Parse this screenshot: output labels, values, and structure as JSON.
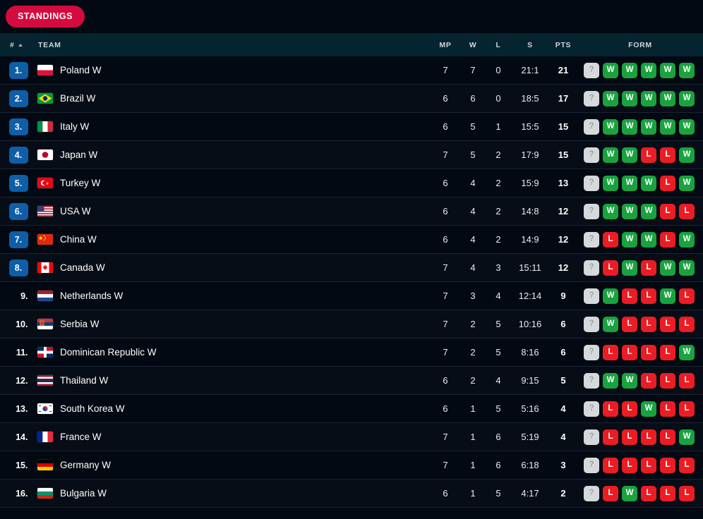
{
  "tabs": [
    {
      "label": "STANDINGS",
      "active": true
    }
  ],
  "colors": {
    "accent": "#d40b3f",
    "rank_badge": "#0f5ea8",
    "win": "#19a33f",
    "loss": "#ec1c24",
    "unknown": "#d6d9db"
  },
  "table": {
    "headers": {
      "rank": "#",
      "sort_indicator": "ascending",
      "team": "TEAM",
      "mp": "MP",
      "w": "W",
      "l": "L",
      "s": "S",
      "pts": "PTS",
      "form": "FORM"
    },
    "rows": [
      {
        "rank": "1.",
        "highlight": true,
        "team": "Poland W",
        "flag": "poland",
        "mp": "7",
        "w": "7",
        "l": "0",
        "s": "21:1",
        "pts": "21",
        "form": [
          "?",
          "W",
          "W",
          "W",
          "W",
          "W"
        ]
      },
      {
        "rank": "2.",
        "highlight": true,
        "team": "Brazil W",
        "flag": "brazil",
        "mp": "6",
        "w": "6",
        "l": "0",
        "s": "18:5",
        "pts": "17",
        "form": [
          "?",
          "W",
          "W",
          "W",
          "W",
          "W"
        ]
      },
      {
        "rank": "3.",
        "highlight": true,
        "team": "Italy W",
        "flag": "italy",
        "mp": "6",
        "w": "5",
        "l": "1",
        "s": "15:5",
        "pts": "15",
        "form": [
          "?",
          "W",
          "W",
          "W",
          "W",
          "W"
        ]
      },
      {
        "rank": "4.",
        "highlight": true,
        "team": "Japan W",
        "flag": "japan",
        "mp": "7",
        "w": "5",
        "l": "2",
        "s": "17:9",
        "pts": "15",
        "form": [
          "?",
          "W",
          "W",
          "L",
          "L",
          "W"
        ]
      },
      {
        "rank": "5.",
        "highlight": true,
        "team": "Turkey W",
        "flag": "turkey",
        "mp": "6",
        "w": "4",
        "l": "2",
        "s": "15:9",
        "pts": "13",
        "form": [
          "?",
          "W",
          "W",
          "W",
          "L",
          "W"
        ]
      },
      {
        "rank": "6.",
        "highlight": true,
        "team": "USA W",
        "flag": "usa",
        "mp": "6",
        "w": "4",
        "l": "2",
        "s": "14:8",
        "pts": "12",
        "form": [
          "?",
          "W",
          "W",
          "W",
          "L",
          "L"
        ]
      },
      {
        "rank": "7.",
        "highlight": true,
        "team": "China W",
        "flag": "china",
        "mp": "6",
        "w": "4",
        "l": "2",
        "s": "14:9",
        "pts": "12",
        "form": [
          "?",
          "L",
          "W",
          "W",
          "L",
          "W"
        ]
      },
      {
        "rank": "8.",
        "highlight": true,
        "team": "Canada W",
        "flag": "canada",
        "mp": "7",
        "w": "4",
        "l": "3",
        "s": "15:11",
        "pts": "12",
        "form": [
          "?",
          "L",
          "W",
          "L",
          "W",
          "W"
        ]
      },
      {
        "rank": "9.",
        "highlight": false,
        "team": "Netherlands W",
        "flag": "netherlands",
        "mp": "7",
        "w": "3",
        "l": "4",
        "s": "12:14",
        "pts": "9",
        "form": [
          "?",
          "W",
          "L",
          "L",
          "W",
          "L"
        ]
      },
      {
        "rank": "10.",
        "highlight": false,
        "team": "Serbia W",
        "flag": "serbia",
        "mp": "7",
        "w": "2",
        "l": "5",
        "s": "10:16",
        "pts": "6",
        "form": [
          "?",
          "W",
          "L",
          "L",
          "L",
          "L"
        ]
      },
      {
        "rank": "11.",
        "highlight": false,
        "team": "Dominican Republic W",
        "flag": "dominican-republic",
        "mp": "7",
        "w": "2",
        "l": "5",
        "s": "8:16",
        "pts": "6",
        "form": [
          "?",
          "L",
          "L",
          "L",
          "L",
          "W"
        ]
      },
      {
        "rank": "12.",
        "highlight": false,
        "team": "Thailand W",
        "flag": "thailand",
        "mp": "6",
        "w": "2",
        "l": "4",
        "s": "9:15",
        "pts": "5",
        "form": [
          "?",
          "W",
          "W",
          "L",
          "L",
          "L"
        ]
      },
      {
        "rank": "13.",
        "highlight": false,
        "team": "South Korea W",
        "flag": "south-korea",
        "mp": "6",
        "w": "1",
        "l": "5",
        "s": "5:16",
        "pts": "4",
        "form": [
          "?",
          "L",
          "L",
          "W",
          "L",
          "L"
        ]
      },
      {
        "rank": "14.",
        "highlight": false,
        "team": "France W",
        "flag": "france",
        "mp": "7",
        "w": "1",
        "l": "6",
        "s": "5:19",
        "pts": "4",
        "form": [
          "?",
          "L",
          "L",
          "L",
          "L",
          "W"
        ]
      },
      {
        "rank": "15.",
        "highlight": false,
        "team": "Germany W",
        "flag": "germany",
        "mp": "7",
        "w": "1",
        "l": "6",
        "s": "6:18",
        "pts": "3",
        "form": [
          "?",
          "L",
          "L",
          "L",
          "L",
          "L"
        ]
      },
      {
        "rank": "16.",
        "highlight": false,
        "team": "Bulgaria W",
        "flag": "bulgaria",
        "mp": "6",
        "w": "1",
        "l": "5",
        "s": "4:17",
        "pts": "2",
        "form": [
          "?",
          "L",
          "W",
          "L",
          "L",
          "L"
        ]
      }
    ]
  }
}
